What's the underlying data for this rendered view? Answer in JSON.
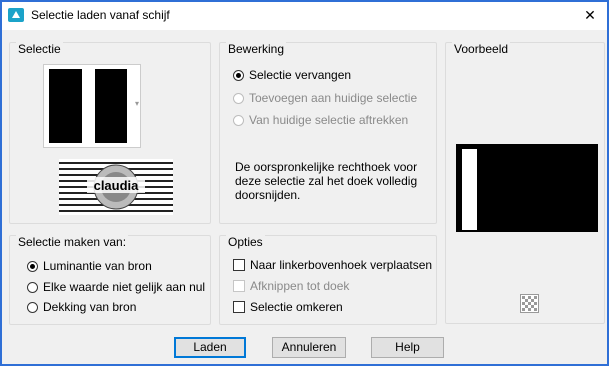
{
  "window": {
    "title": "Selectie laden vanaf schijf",
    "close_glyph": "✕"
  },
  "selectie": {
    "label": "Selectie",
    "logo_text": "claudia"
  },
  "bewerking": {
    "label": "Bewerking",
    "options": [
      {
        "label": "Selectie vervangen",
        "selected": true,
        "enabled": true
      },
      {
        "label": "Toevoegen aan huidige selectie",
        "selected": false,
        "enabled": false
      },
      {
        "label": "Van huidige selectie aftrekken",
        "selected": false,
        "enabled": false
      }
    ],
    "description": "De oorspronkelijke rechthoek voor deze selectie zal het doek volledig doorsnijden."
  },
  "voorbeeld": {
    "label": "Voorbeeld"
  },
  "maken_van": {
    "label": "Selectie maken van:",
    "options": [
      {
        "label": "Luminantie van bron",
        "selected": true
      },
      {
        "label": "Elke waarde niet gelijk aan nul",
        "selected": false
      },
      {
        "label": "Dekking van bron",
        "selected": false
      }
    ]
  },
  "opties": {
    "label": "Opties",
    "options": [
      {
        "label": "Naar linkerbovenhoek verplaatsen",
        "checked": false,
        "enabled": true
      },
      {
        "label": "Afknippen tot doek",
        "checked": false,
        "enabled": false
      },
      {
        "label": "Selectie omkeren",
        "checked": false,
        "enabled": true
      }
    ]
  },
  "buttons": {
    "load": "Laden",
    "cancel": "Annuleren",
    "help": "Help"
  }
}
